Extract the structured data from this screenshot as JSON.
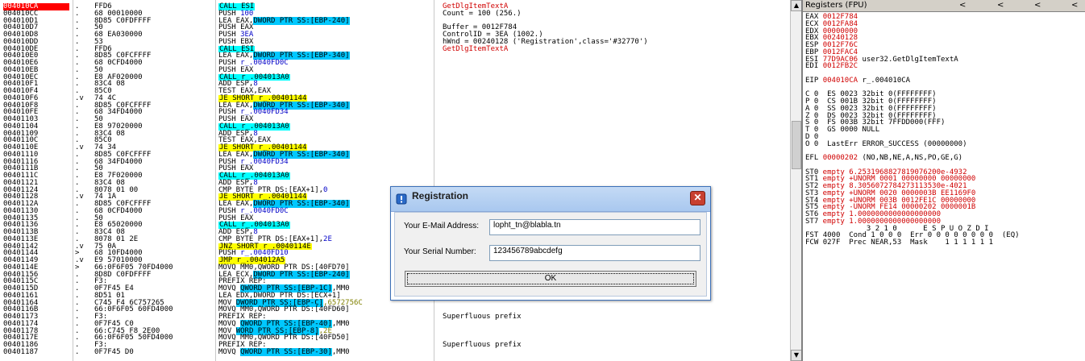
{
  "cpu": {
    "rows": [
      {
        "addr": "004010CA",
        "sym": ".",
        "hex": "FFD6",
        "asm": [
          [
            "call",
            "CALL ESI"
          ]
        ],
        "cmt": "GetDlgItemTextA",
        "cmtc": "red",
        "sel": true
      },
      {
        "addr": "004010CC",
        "sym": ".",
        "hex": "68 00010000",
        "asm": [
          [
            "plain",
            "PUSH "
          ],
          [
            "blue",
            "100"
          ]
        ],
        "cmt": "Count = 100 (256.)"
      },
      {
        "addr": "004010D1",
        "sym": ".",
        "hex": "8D85 C0FDFFFF",
        "asm": [
          [
            "plain",
            "LEA EAX,"
          ],
          [
            "mem",
            "DWORD PTR SS:[EBP-240]"
          ]
        ],
        "cmt": ""
      },
      {
        "addr": "004010D7",
        "sym": ".",
        "hex": "50",
        "asm": [
          [
            "plain",
            "PUSH EAX"
          ]
        ],
        "cmt": "Buffer = 0012F784"
      },
      {
        "addr": "004010D8",
        "sym": ".",
        "hex": "68 EA030000",
        "asm": [
          [
            "plain",
            "PUSH "
          ],
          [
            "blue",
            "3EA"
          ]
        ],
        "cmt": "ControlID = 3EA (1002.)"
      },
      {
        "addr": "004010DD",
        "sym": ".",
        "hex": "53",
        "asm": [
          [
            "plain",
            "PUSH EBX"
          ]
        ],
        "cmt": "hWnd = 00240128 ('Registration',class='#32770')"
      },
      {
        "addr": "004010DE",
        "sym": ".",
        "hex": "FFD6",
        "asm": [
          [
            "call",
            "CALL ESI"
          ]
        ],
        "cmt": "GetDlgItemTextA",
        "cmtc": "red"
      },
      {
        "addr": "004010E0",
        "sym": ".",
        "hex": "8D85 C0FCFFFF",
        "asm": [
          [
            "plain",
            "LEA EAX,"
          ],
          [
            "mem",
            "DWORD PTR SS:[EBP-340]"
          ]
        ],
        "cmt": ""
      },
      {
        "addr": "004010E6",
        "sym": ".",
        "hex": "68 0CFD4000",
        "asm": [
          [
            "plain",
            "PUSH "
          ],
          [
            "blue",
            "r_.0040FD0C"
          ]
        ],
        "cmt": ""
      },
      {
        "addr": "004010EB",
        "sym": ".",
        "hex": "50",
        "asm": [
          [
            "plain",
            "PUSH EAX"
          ]
        ],
        "cmt": ""
      },
      {
        "addr": "004010EC",
        "sym": ".",
        "hex": "E8 AF020000",
        "asm": [
          [
            "call",
            "CALL r_.004013A0"
          ]
        ],
        "cmt": ""
      },
      {
        "addr": "004010F1",
        "sym": ".",
        "hex": "83C4 08",
        "asm": [
          [
            "plain",
            "ADD ESP,"
          ],
          [
            "blue",
            "8"
          ]
        ],
        "cmt": ""
      },
      {
        "addr": "004010F4",
        "sym": ".",
        "hex": "85C0",
        "asm": [
          [
            "plain",
            "TEST EAX,EAX"
          ]
        ],
        "cmt": ""
      },
      {
        "addr": "004010F6",
        "sym": ".v",
        "hex": "74 4C",
        "asm": [
          [
            "jmp",
            "JE SHORT r_.00401144"
          ]
        ],
        "cmt": ""
      },
      {
        "addr": "004010F8",
        "sym": ".",
        "hex": "8D85 C0FCFFFF",
        "asm": [
          [
            "plain",
            "LEA EAX,"
          ],
          [
            "mem",
            "DWORD PTR SS:[EBP-340]"
          ]
        ],
        "cmt": ""
      },
      {
        "addr": "004010FE",
        "sym": ".",
        "hex": "68 34FD4000",
        "asm": [
          [
            "plain",
            "PUSH "
          ],
          [
            "blue",
            "r_.0040FD34"
          ]
        ],
        "cmt": ""
      },
      {
        "addr": "00401103",
        "sym": ".",
        "hex": "50",
        "asm": [
          [
            "plain",
            "PUSH EAX"
          ]
        ],
        "cmt": ""
      },
      {
        "addr": "00401104",
        "sym": ".",
        "hex": "E8 97020000",
        "asm": [
          [
            "call",
            "CALL r_.004013A0"
          ]
        ],
        "cmt": ""
      },
      {
        "addr": "00401109",
        "sym": ".",
        "hex": "83C4 08",
        "asm": [
          [
            "plain",
            "ADD ESP,"
          ],
          [
            "blue",
            "8"
          ]
        ],
        "cmt": ""
      },
      {
        "addr": "0040110C",
        "sym": ".",
        "hex": "85C0",
        "asm": [
          [
            "plain",
            "TEST EAX,EAX"
          ]
        ],
        "cmt": ""
      },
      {
        "addr": "0040110E",
        "sym": ".v",
        "hex": "74 34",
        "asm": [
          [
            "jmp",
            "JE SHORT r_.00401144"
          ]
        ],
        "cmt": ""
      },
      {
        "addr": "00401110",
        "sym": ".",
        "hex": "8D85 C0FCFFFF",
        "asm": [
          [
            "plain",
            "LEA EAX,"
          ],
          [
            "mem",
            "DWORD PTR SS:[EBP-340]"
          ]
        ],
        "cmt": ""
      },
      {
        "addr": "00401116",
        "sym": ".",
        "hex": "68 34FD4000",
        "asm": [
          [
            "plain",
            "PUSH "
          ],
          [
            "blue",
            "r_.0040FD34"
          ]
        ],
        "cmt": ""
      },
      {
        "addr": "0040111B",
        "sym": ".",
        "hex": "50",
        "asm": [
          [
            "plain",
            "PUSH EAX"
          ]
        ],
        "cmt": ""
      },
      {
        "addr": "0040111C",
        "sym": ".",
        "hex": "E8 7F020000",
        "asm": [
          [
            "call",
            "CALL r_.004013A0"
          ]
        ],
        "cmt": ""
      },
      {
        "addr": "00401121",
        "sym": ".",
        "hex": "83C4 08",
        "asm": [
          [
            "plain",
            "ADD ESP,"
          ],
          [
            "blue",
            "8"
          ]
        ],
        "cmt": ""
      },
      {
        "addr": "00401124",
        "sym": ".",
        "hex": "8078 01 00",
        "asm": [
          [
            "plain",
            "CMP BYTE PTR DS:[EAX+1],"
          ],
          [
            "blue",
            "0"
          ]
        ],
        "cmt": ""
      },
      {
        "addr": "00401128",
        "sym": ".v",
        "hex": "74 1A",
        "asm": [
          [
            "jmp",
            "JE SHORT r_.00401144"
          ]
        ],
        "cmt": ""
      },
      {
        "addr": "0040112A",
        "sym": ".",
        "hex": "8D85 C0FCFFFF",
        "asm": [
          [
            "plain",
            "LEA EAX,"
          ],
          [
            "mem",
            "DWORD PTR SS:[EBP-340]"
          ]
        ],
        "cmt": ""
      },
      {
        "addr": "00401130",
        "sym": ".",
        "hex": "68 0CFD4000",
        "asm": [
          [
            "plain",
            "PUSH "
          ],
          [
            "blue",
            "r_.0040FD0C"
          ]
        ],
        "cmt": ""
      },
      {
        "addr": "00401135",
        "sym": ".",
        "hex": "50",
        "asm": [
          [
            "plain",
            "PUSH EAX"
          ]
        ],
        "cmt": ""
      },
      {
        "addr": "00401136",
        "sym": ".",
        "hex": "E8 65020000",
        "asm": [
          [
            "call",
            "CALL r_.004013A0"
          ]
        ],
        "cmt": ""
      },
      {
        "addr": "0040113B",
        "sym": ".",
        "hex": "83C4 08",
        "asm": [
          [
            "plain",
            "ADD ESP,"
          ],
          [
            "blue",
            "8"
          ]
        ],
        "cmt": ""
      },
      {
        "addr": "0040113E",
        "sym": ".",
        "hex": "8078 01 2E",
        "asm": [
          [
            "plain",
            "CMP BYTE PTR DS:[EAX+1],"
          ],
          [
            "blue",
            "2E"
          ]
        ],
        "cmt": ""
      },
      {
        "addr": "00401142",
        "sym": ".v",
        "hex": "75 0A",
        "asm": [
          [
            "jmp",
            "JNZ SHORT r_.0040114E"
          ]
        ],
        "cmt": ""
      },
      {
        "addr": "00401144",
        "sym": ">",
        "hex": "68 10FD4000",
        "asm": [
          [
            "plain",
            "PUSH "
          ],
          [
            "blue",
            "r_.0040FD10"
          ]
        ],
        "cmt": ""
      },
      {
        "addr": "00401149",
        "sym": ".v",
        "hex": "E9 57010000",
        "asm": [
          [
            "jmp",
            "JMP r_.004012A5"
          ]
        ],
        "cmt": ""
      },
      {
        "addr": "0040114E",
        "sym": ">",
        "hex": "66:0F6F05 70FD4000",
        "asm": [
          [
            "plain",
            "MOVQ MM0,QWORD PTR DS:[40FD70]"
          ]
        ],
        "cmt": ""
      },
      {
        "addr": "00401156",
        "sym": ".",
        "hex": "8D8D C0FDFFFF",
        "asm": [
          [
            "plain",
            "LEA ECX,"
          ],
          [
            "mem",
            "DWORD PTR SS:[EBP-240]"
          ]
        ],
        "cmt": ""
      },
      {
        "addr": "0040115C",
        "sym": ".",
        "hex": "F3:",
        "asm": [
          [
            "plain",
            "PREFIX REP:"
          ]
        ],
        "cmt": ""
      },
      {
        "addr": "0040115D",
        "sym": ".",
        "hex": "0F7F45 E4",
        "asm": [
          [
            "plain",
            "MOVQ "
          ],
          [
            "mem",
            "QWORD PTR SS:[EBP-1C]"
          ],
          [
            "plain",
            ",MM0"
          ]
        ],
        "cmt": ""
      },
      {
        "addr": "00401161",
        "sym": ".",
        "hex": "8D51 01",
        "asm": [
          [
            "plain",
            "LEA EDX,DWORD PTR DS:[ECX+1]"
          ]
        ],
        "cmt": ""
      },
      {
        "addr": "00401164",
        "sym": ".",
        "hex": "C745 F4 6C757265",
        "asm": [
          [
            "plain",
            "MOV "
          ],
          [
            "mem",
            "DWORD PTR SS:[EBP-C]"
          ],
          [
            "olive",
            ",6572756C"
          ]
        ],
        "cmt": ""
      },
      {
        "addr": "0040116B",
        "sym": ".",
        "hex": "66:0F6F05 60FD4000",
        "asm": [
          [
            "plain",
            "MOVQ MM0,QWORD PTR DS:[40FD60]"
          ]
        ],
        "cmt": ""
      },
      {
        "addr": "00401173",
        "sym": ".",
        "hex": "F3:",
        "asm": [
          [
            "plain",
            "PREFIX REP:"
          ]
        ],
        "cmt": "Superfluous prefix"
      },
      {
        "addr": "00401174",
        "sym": ".",
        "hex": "0F7F45 C0",
        "asm": [
          [
            "plain",
            "MOVQ "
          ],
          [
            "mem",
            "QWORD PTR SS:[EBP-40]"
          ],
          [
            "plain",
            ",MM0"
          ]
        ],
        "cmt": ""
      },
      {
        "addr": "00401178",
        "sym": ".",
        "hex": "66:C745 F8 2E00",
        "asm": [
          [
            "plain",
            "MOV "
          ],
          [
            "mem",
            "WORD PTR SS:[EBP-8]"
          ],
          [
            "olive",
            ",2E"
          ]
        ],
        "cmt": ""
      },
      {
        "addr": "0040117E",
        "sym": ".",
        "hex": "66:0F6F05 50FD4000",
        "asm": [
          [
            "plain",
            "MOVQ MM0,QWORD PTR DS:[40FD50]"
          ]
        ],
        "cmt": ""
      },
      {
        "addr": "00401186",
        "sym": ".",
        "hex": "F3:",
        "asm": [
          [
            "plain",
            "PREFIX REP:"
          ]
        ],
        "cmt": "Superfluous prefix"
      },
      {
        "addr": "00401187",
        "sym": ".",
        "hex": "0F7F45 D0",
        "asm": [
          [
            "plain",
            "MOVQ "
          ],
          [
            "mem",
            "QWORD PTR SS:[EBP-30]"
          ],
          [
            "plain",
            ",MM0"
          ]
        ],
        "cmt": ""
      }
    ]
  },
  "regs": {
    "title": "Registers (FPU)",
    "nav": [
      "<",
      "<",
      "<",
      "<"
    ],
    "lines": [
      {
        "t": "EAX",
        "v": "0012F784",
        "vc": "red",
        "x": ""
      },
      {
        "t": "ECX",
        "v": "0012FA84",
        "vc": "red",
        "x": ""
      },
      {
        "t": "EDX",
        "v": "00000000",
        "vc": "red",
        "x": ""
      },
      {
        "t": "EBX",
        "v": "00240128",
        "vc": "red",
        "x": ""
      },
      {
        "t": "ESP",
        "v": "0012F76C",
        "vc": "red",
        "x": ""
      },
      {
        "t": "EBP",
        "v": "0012FAC4",
        "vc": "red",
        "x": ""
      },
      {
        "t": "ESI",
        "v": "77D9AC06",
        "vc": "red",
        "x": " user32.GetDlgItemTextA"
      },
      {
        "t": "EDI",
        "v": "0012FB2C",
        "vc": "red",
        "x": ""
      },
      {
        "t": "",
        "v": "",
        "vc": "blk",
        "x": ""
      },
      {
        "t": "EIP",
        "v": "004010CA",
        "vc": "red",
        "x": " r_.004010CA"
      },
      {
        "t": "",
        "v": "",
        "vc": "blk",
        "x": ""
      },
      {
        "t": "C 0",
        "v": "",
        "vc": "blk",
        "x": "  ES 0023 32bit 0(FFFFFFFF)"
      },
      {
        "t": "P 0",
        "v": "",
        "vc": "blk",
        "x": "  CS 001B 32bit 0(FFFFFFFF)"
      },
      {
        "t": "A 0",
        "v": "",
        "vc": "blk",
        "x": "  SS 0023 32bit 0(FFFFFFFF)"
      },
      {
        "t": "Z 0",
        "v": "",
        "vc": "blk",
        "x": "  DS 0023 32bit 0(FFFFFFFF)"
      },
      {
        "t": "S 0",
        "v": "",
        "vc": "blk",
        "x": "  FS 003B 32bit 7FFDD000(FFF)"
      },
      {
        "t": "T 0",
        "v": "",
        "vc": "blk",
        "x": "  GS 0000 NULL"
      },
      {
        "t": "D 0",
        "v": "",
        "vc": "blk",
        "x": ""
      },
      {
        "t": "O 0",
        "v": "",
        "vc": "blk",
        "x": "  LastErr ERROR_SUCCESS (00000000)"
      },
      {
        "t": "",
        "v": "",
        "vc": "blk",
        "x": ""
      },
      {
        "t": "EFL",
        "v": "00000202",
        "vc": "red",
        "x": " (NO,NB,NE,A,NS,PO,GE,G)"
      },
      {
        "t": "",
        "v": "",
        "vc": "blk",
        "x": ""
      },
      {
        "t": "ST0",
        "v": "",
        "vc": "blk",
        "x": " empty 6.2531968827819076200e-4932"
      },
      {
        "t": "ST1",
        "v": "",
        "vc": "blk",
        "x": " empty +UNORM 0001 00000000 00000000"
      },
      {
        "t": "ST2",
        "v": "",
        "vc": "blk",
        "x": " empty 8.3056072784273113530e-4021"
      },
      {
        "t": "ST3",
        "v": "",
        "vc": "blk",
        "x": " empty +UNORM 0020 0000003B EE1169F0"
      },
      {
        "t": "ST4",
        "v": "",
        "vc": "blk",
        "x": " empty +UNORM 003B 0012FE1C 00000000"
      },
      {
        "t": "ST5",
        "v": "",
        "vc": "blk",
        "x": " empty -UNORM FE14 00000202 0000001B"
      },
      {
        "t": "ST6",
        "v": "",
        "vc": "blk",
        "x": " empty 1.0000000000000000000"
      },
      {
        "t": "ST7",
        "v": "",
        "vc": "blk",
        "x": " empty 1.0000000000000000000"
      },
      {
        "t": "",
        "v": "",
        "vc": "blk",
        "x": "              3 2 1 0      E S P U O Z D I"
      },
      {
        "t": "FST",
        "v": "4000",
        "vc": "blk",
        "x": "  Cond 1 0 0 0  Err 0 0 0 0 0 0 0 0  (EQ)"
      },
      {
        "t": "FCW",
        "v": "027F",
        "vc": "blk",
        "x": "  Prec NEAR,53  Mask    1 1 1 1 1 1"
      }
    ]
  },
  "dialog": {
    "title": "Registration",
    "close_label": "✕",
    "email_label": "Your E-Mail Address:",
    "email_value": "lopht_tn@blabla.tn",
    "serial_label": "Your Serial Number:",
    "serial_value": "123456789abcdefg",
    "ok_label": "OK"
  },
  "icons": {
    "dialog_icon": "app-icon",
    "scroll_up": "scroll-up-icon",
    "scroll_down": "scroll-down-icon"
  },
  "colors": {
    "selected_addr": "#ff0000",
    "call_highlight": "#00ffff",
    "jump_highlight": "#ffff00",
    "memory_highlight": "#00c8ff",
    "register_changed": "#d00000"
  }
}
